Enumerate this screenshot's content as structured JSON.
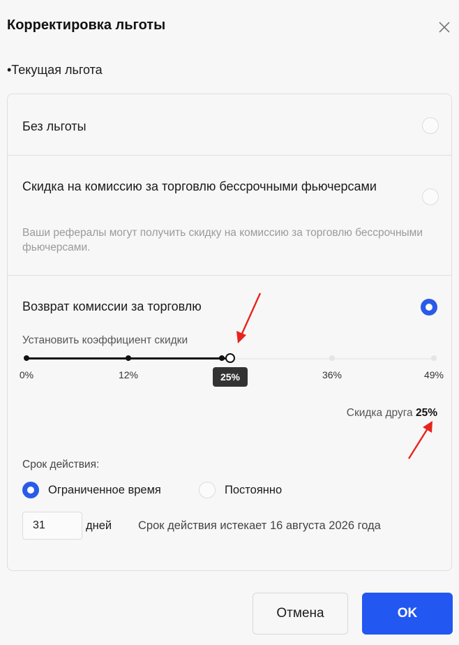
{
  "dialog": {
    "title": "Корректировка льготы",
    "close_icon": "close-icon"
  },
  "current_benefit": {
    "title": "•Текущая льгота"
  },
  "options": [
    {
      "label": "Без льготы",
      "selected": false
    },
    {
      "label": "Скидка на комиссию за торговлю бессрочными фьючерсами",
      "description": "Ваши рефералы могут получить скидку на комиссию за торговлю бессрочными фьючерсами.",
      "selected": false
    },
    {
      "label": "Возврат комиссии за торговлю",
      "selected": true
    }
  ],
  "rebate": {
    "slider_caption": "Установить коэффициент скидки",
    "ticks": [
      {
        "label": "0%",
        "value": 0
      },
      {
        "label": "12%",
        "value": 12
      },
      {
        "label": "25%",
        "value": 25
      },
      {
        "label": "36%",
        "value": 36
      },
      {
        "label": "49%",
        "value": 49
      }
    ],
    "min": 0,
    "max": 49,
    "current_value": 25,
    "current_value_label": "25%",
    "friend_discount_label": "Скидка друга",
    "friend_discount_value": "25%"
  },
  "validity": {
    "label": "Срок действия:",
    "options": [
      {
        "label": "Ограниченное время",
        "selected": true
      },
      {
        "label": "Постоянно",
        "selected": false
      }
    ],
    "days_value": "31",
    "days_unit": "дней",
    "expiry_text": "Срок действия истекает 16 августа 2026 года"
  },
  "footer": {
    "cancel_label": "Отмена",
    "ok_label": "OK"
  },
  "colors": {
    "accent": "#2357f1",
    "radio_selected": "#2a5be8",
    "annotation_arrow": "#e8231e"
  }
}
